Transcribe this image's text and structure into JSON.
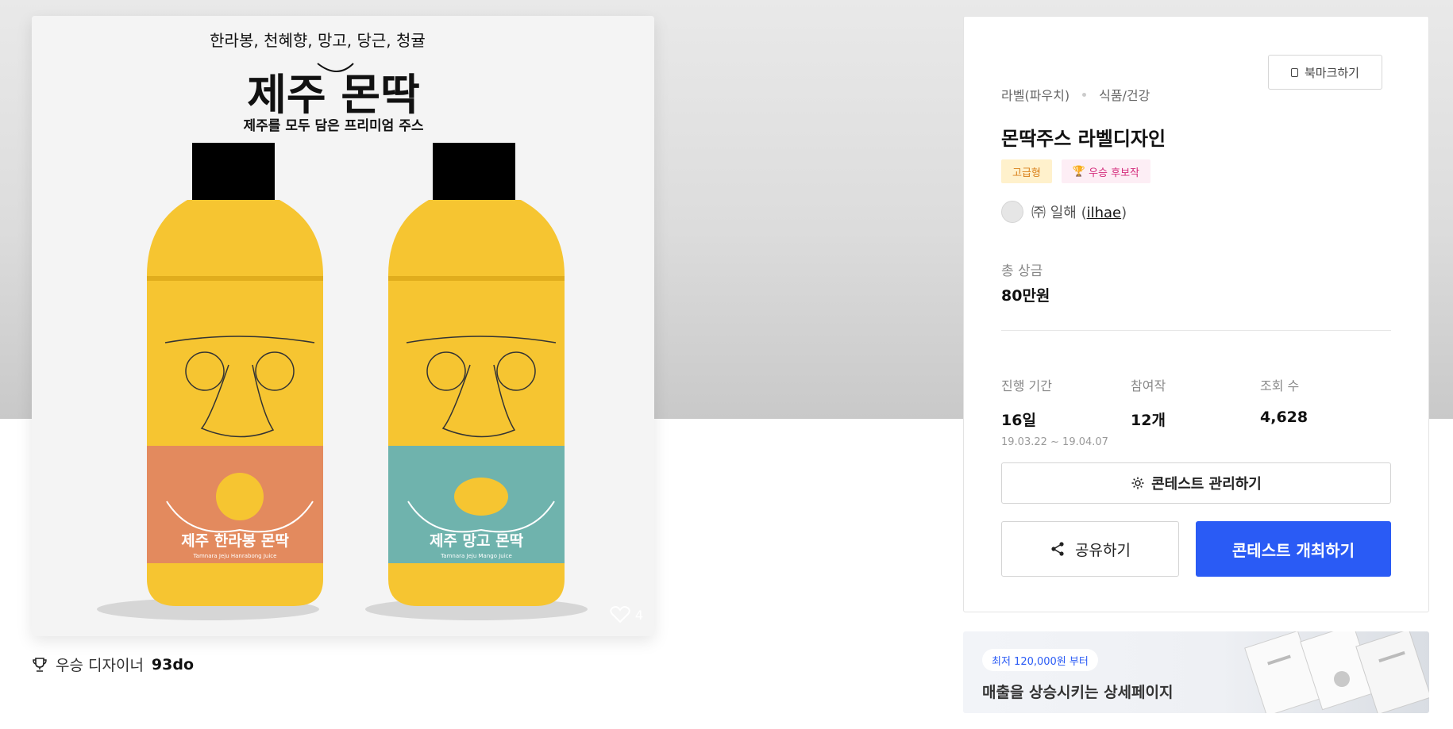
{
  "image": {
    "handwritten_note": "한라봉, 천혜향, 망고, 당근, 청귤",
    "product_title": "제주 몬딱",
    "product_subtitle": "제주를 모두 담은 프리미엄 주스",
    "left_bottle_label": "제주 한라봉 몬딱",
    "left_bottle_sublabel": "Tamnara Jeju Hanrabong Juice",
    "right_bottle_label": "제주 망고 몬딱",
    "right_bottle_sublabel": "Tamnara Jeju Mango Juice",
    "like_count": "4",
    "colors": {
      "bottle_yellow": "#f6c531",
      "cap": "#000000",
      "orange_band": "#e38a5e",
      "teal_band": "#6fb3ad"
    }
  },
  "winner": {
    "prefix": "우승 디자이너",
    "name": "93do"
  },
  "panel": {
    "bookmark_label": "북마크하기",
    "breadcrumb": [
      "라벨(파우치)",
      "식품/건강"
    ],
    "title": "몬딱주스 라벨디자인",
    "badges": {
      "grade": "고급형",
      "winner": "우승 후보작"
    },
    "company": {
      "name": "㈜ 일해 (",
      "handle": "ilhae",
      "close": ")"
    },
    "prize": {
      "label": "총 상금",
      "value": "80만원"
    },
    "stats": {
      "period": {
        "label": "진행 기간",
        "value": "16일",
        "range": "19.03.22 ~ 19.04.07"
      },
      "entries": {
        "label": "참여작",
        "value": "12개"
      },
      "views": {
        "label": "조회 수",
        "value": "4,628"
      }
    },
    "manage_button": "콘테스트 관리하기",
    "share_button": "공유하기",
    "host_button": "콘테스트 개최하기",
    "colors": {
      "primary": "#2a5bf5"
    }
  },
  "ad": {
    "pill": "최저 120,000원 부터",
    "text": "매출을 상승시키는 상세페이지"
  }
}
